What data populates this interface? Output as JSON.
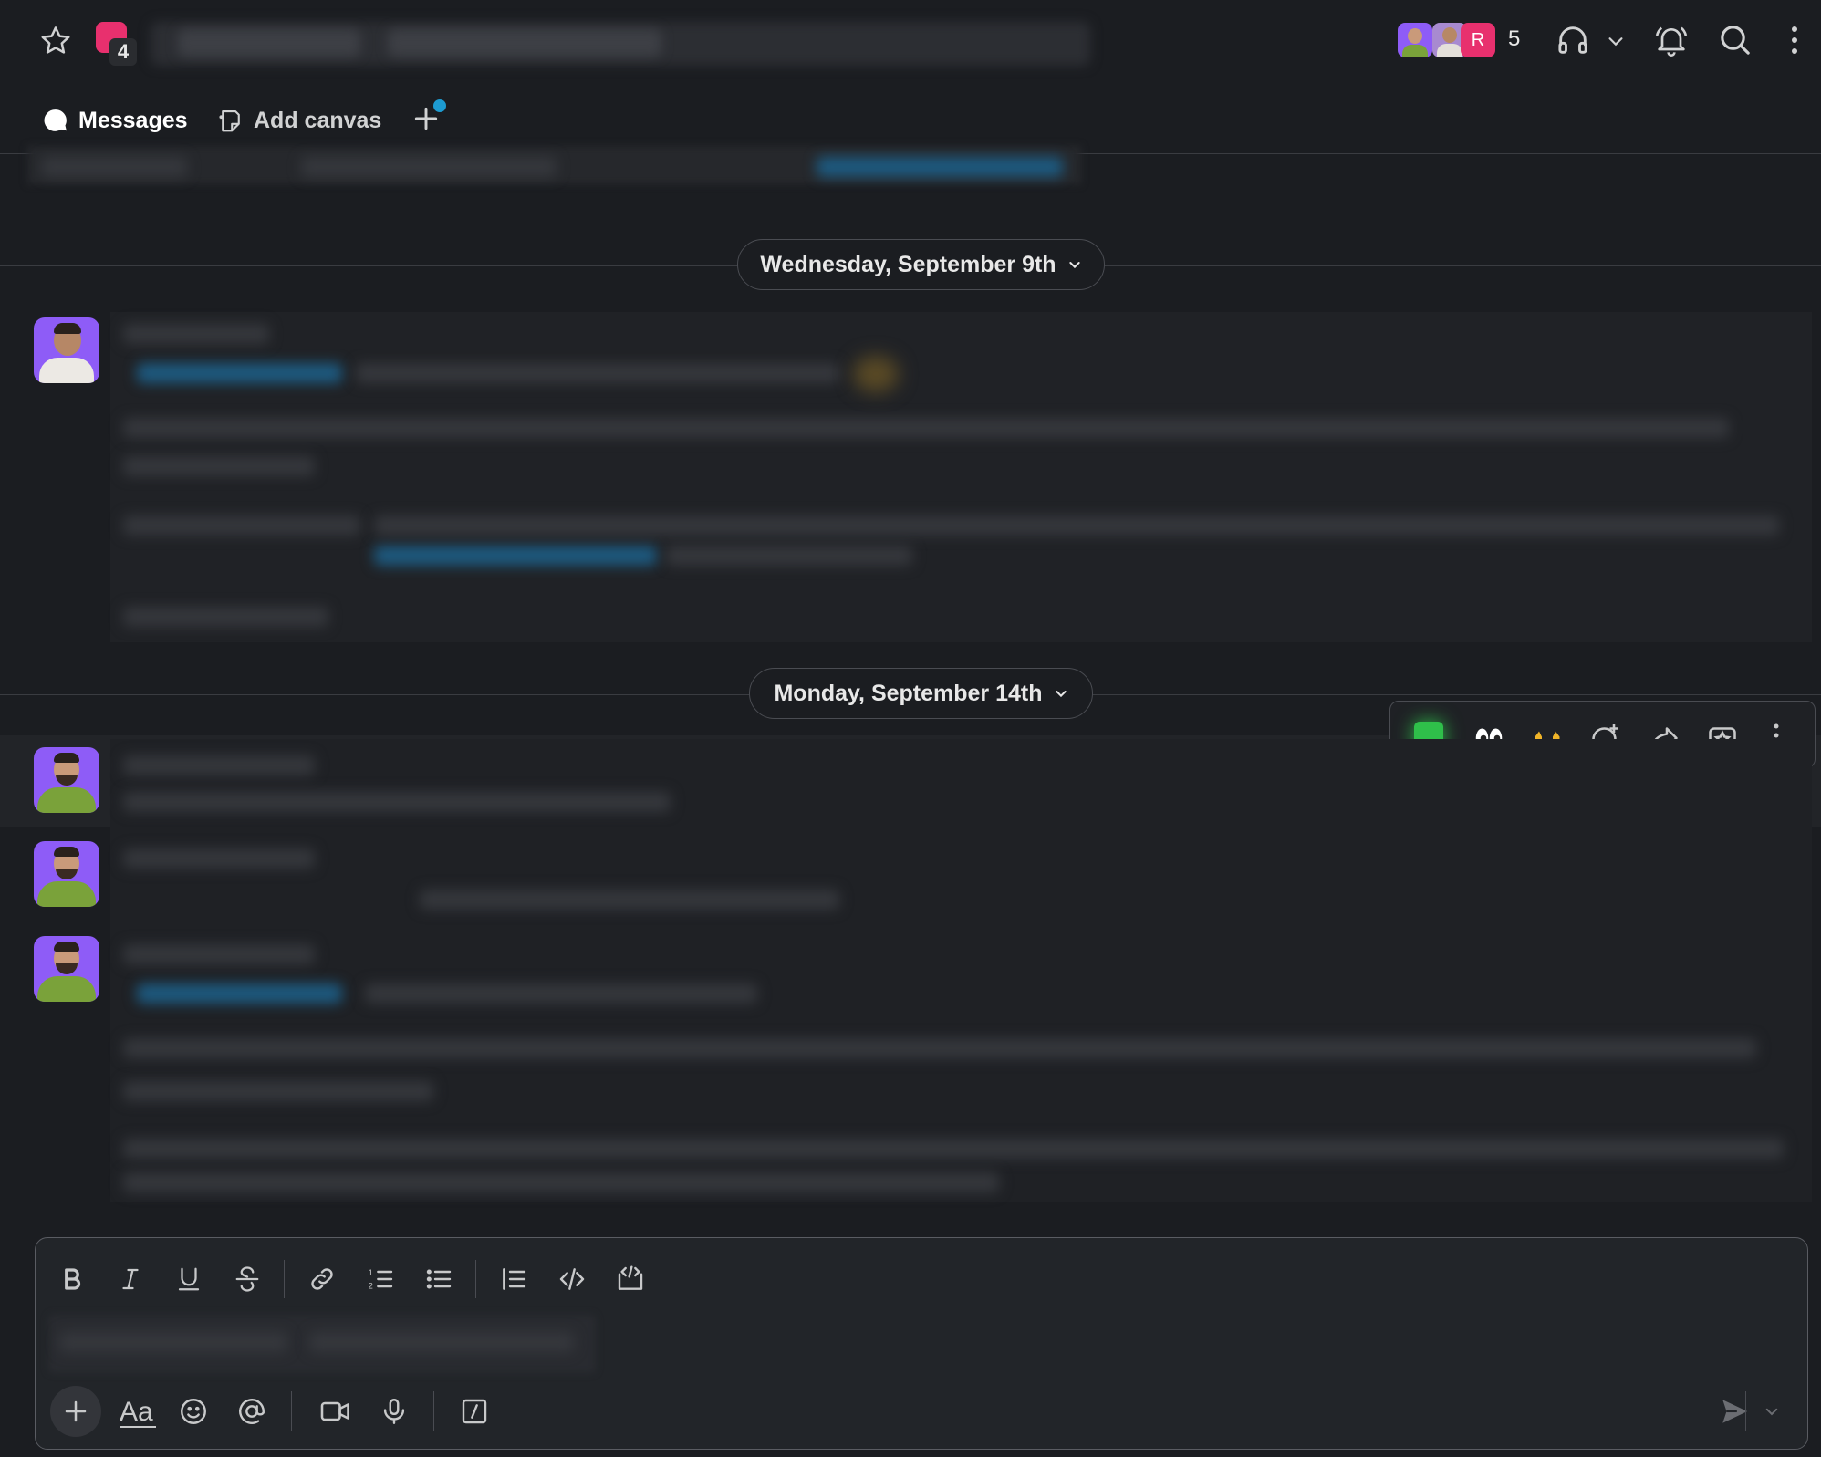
{
  "header": {
    "workspace_badge_count": "4",
    "member_avatar_initial": "R",
    "member_count": "5"
  },
  "tabs": {
    "messages_label": "Messages",
    "add_canvas_label": "Add canvas"
  },
  "dividers": {
    "day1_label": "Wednesday, September 9th",
    "day2_label": "Monday, September 14th"
  },
  "colors": {
    "background": "#1b1d21",
    "accent_blue": "#1d9bd1",
    "badge_pink": "#e8306e",
    "avatar_purple": "#8e5cf7",
    "avatar_shirt_green": "#7aa23a"
  },
  "icons": {
    "header": [
      "star-icon",
      "headphones-icon",
      "chevron-down-icon",
      "bell-icon",
      "search-icon",
      "more-vertical-icon"
    ],
    "tabs": [
      "message-bubble-icon",
      "canvas-icon",
      "plus-icon"
    ],
    "hover_toolbar": [
      "check-mark-emoji-icon",
      "eyes-emoji-icon",
      "raised-hands-emoji-icon",
      "add-reaction-icon",
      "forward-icon",
      "bookmark-icon",
      "more-vertical-icon"
    ],
    "formatting": [
      "bold-icon",
      "italic-icon",
      "underline-icon",
      "strikethrough-icon",
      "link-icon",
      "ordered-list-icon",
      "bulleted-list-icon",
      "blockquote-icon",
      "code-icon",
      "code-block-icon"
    ],
    "composer_actions": [
      "plus-icon",
      "formatting-aa-icon",
      "emoji-icon",
      "mention-icon",
      "video-icon",
      "microphone-icon",
      "slash-command-icon",
      "send-icon",
      "chevron-down-icon"
    ]
  }
}
